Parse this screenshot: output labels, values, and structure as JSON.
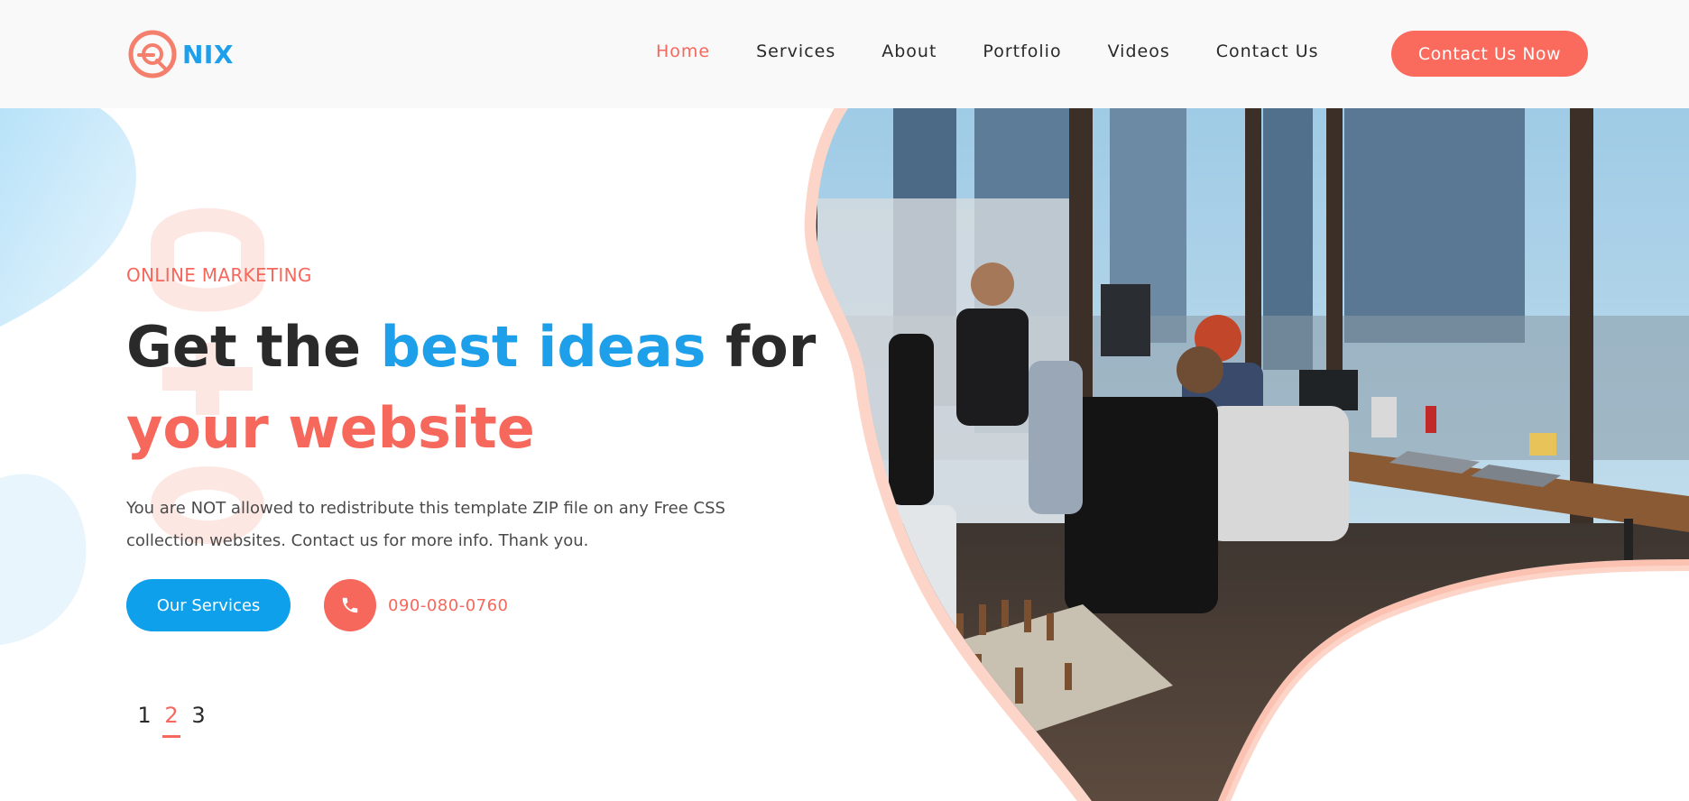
{
  "header": {
    "logo_text": "NIX",
    "nav": [
      {
        "label": "Home",
        "active": true
      },
      {
        "label": "Services",
        "active": false
      },
      {
        "label": "About",
        "active": false
      },
      {
        "label": "Portfolio",
        "active": false
      },
      {
        "label": "Videos",
        "active": false
      },
      {
        "label": "Contact Us",
        "active": false
      }
    ],
    "cta_label": "Contact Us Now"
  },
  "hero": {
    "kicker": "ONLINE MARKETING",
    "title_part1": "Get the ",
    "title_highlight_blue": "best ideas",
    "title_part2": " for",
    "title_highlight_coral": "your website",
    "description": "You are NOT allowed to redistribute this template ZIP file on any Free CSS collection websites. Contact us for more info. Thank you.",
    "services_button": "Our Services",
    "phone_number": "090-080-0760",
    "phone_icon": "phone-icon",
    "image_icon": "office-photo"
  },
  "pagination": {
    "pages": [
      "1",
      "2",
      "3"
    ],
    "active_index": 1
  },
  "colors": {
    "accent_coral": "#f6675c",
    "accent_blue": "#1e9fea",
    "cta_background": "#fa6b5d",
    "header_background": "#f9f9fa",
    "image_border": "#fdd4c8"
  }
}
